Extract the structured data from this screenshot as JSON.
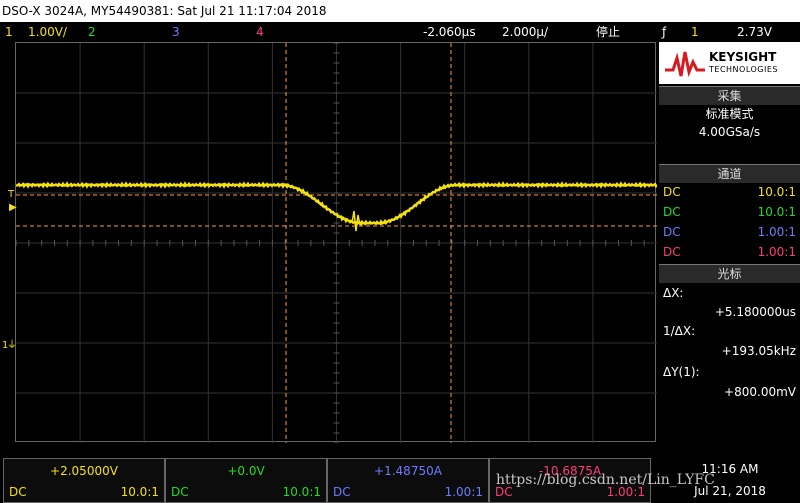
{
  "title": "DSO-X 3024A, MY54490381: Sat Jul 21 11:17:04 2018",
  "top": {
    "ch1_num": "1",
    "ch1_scale": "1.00V/",
    "ch2_num": "2",
    "ch3_num": "3",
    "ch4_num": "4",
    "delay": "-2.060µs",
    "timebase": "2.000µ/",
    "run_state": "停止",
    "trig_edge": "ƒ",
    "trig_ch": "1",
    "trig_level": "2.73V"
  },
  "screen": {
    "grid_h_divs": 10,
    "grid_v_divs": 8,
    "trigger_marker": "T",
    "ground_marker": "1",
    "trace_color": "#f4e10f",
    "cursor_color": "#ff9a3c"
  },
  "panel": {
    "logo_word": "KEYSIGHT",
    "logo_sub": "TECHNOLOGIES",
    "acq_header": "采集",
    "acq_mode": "标准模式",
    "acq_rate": "4.00GSa/s",
    "ch_header": "通道",
    "channels": [
      {
        "coupling": "DC",
        "probe": "10.0:1"
      },
      {
        "coupling": "DC",
        "probe": "10.0:1"
      },
      {
        "coupling": "DC",
        "probe": "1.00:1"
      },
      {
        "coupling": "DC",
        "probe": "1.00:1"
      }
    ],
    "cursor_header": "光标",
    "dx_label": "ΔX:",
    "dx_value": "+5.180000us",
    "inv_dx_label": "1/ΔX:",
    "inv_dx_value": "+193.05kHz",
    "dy_label": "ΔY(1):",
    "dy_value": "+800.00mV"
  },
  "bottom": {
    "channels": [
      {
        "value": "+2.05000V",
        "coupling": "DC",
        "probe": "10.0:1"
      },
      {
        "value": "+0.0V",
        "coupling": "DC",
        "probe": "10.0:1"
      },
      {
        "value": "+1.48750A",
        "coupling": "DC",
        "probe": "1.00:1"
      },
      {
        "value": "-10.6875A",
        "coupling": "DC",
        "probe": "1.00:1"
      }
    ],
    "time": "11:16 AM",
    "date": "Jul 21, 2018"
  },
  "watermark": "https://blog.csdn.net/Lin_LYFC"
}
